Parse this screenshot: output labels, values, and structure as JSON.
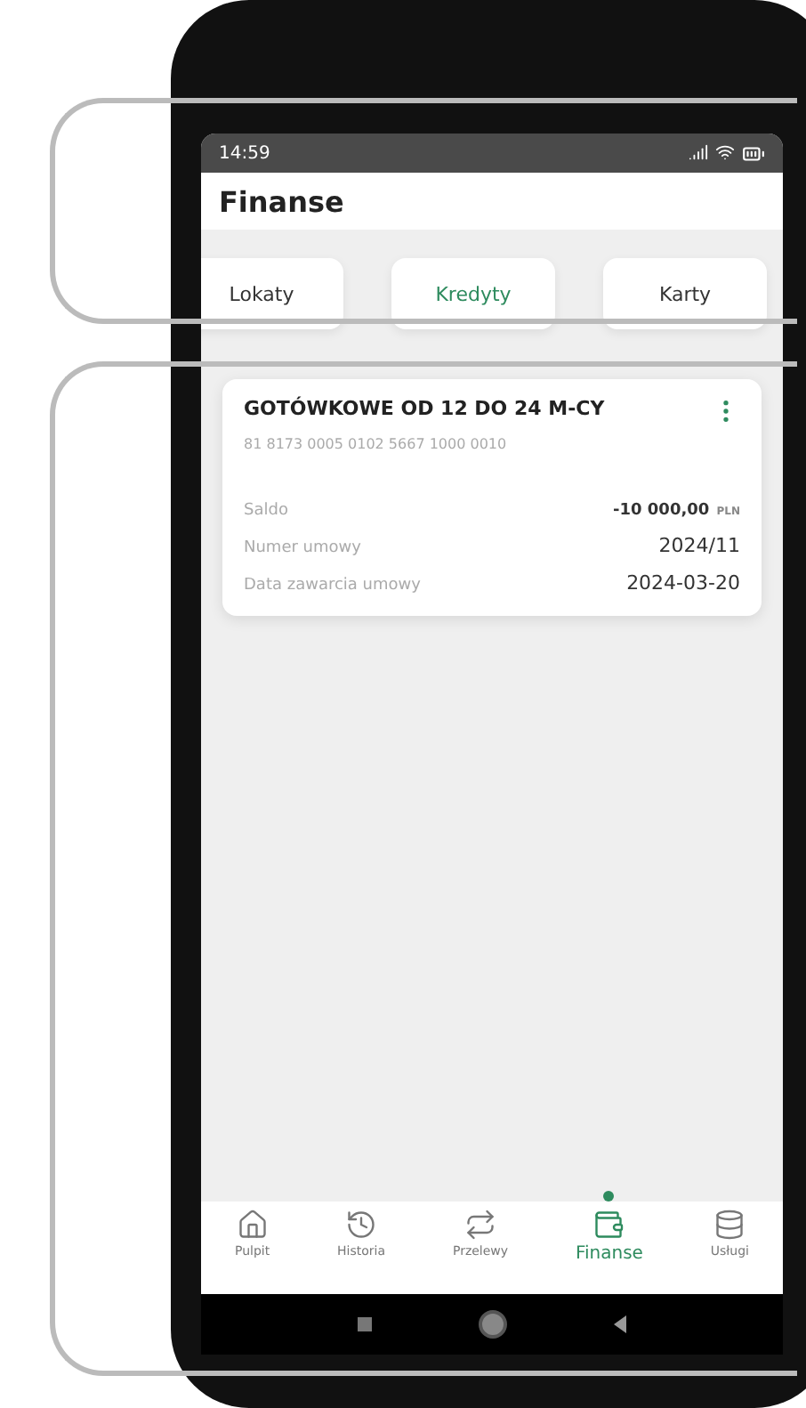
{
  "status_bar": {
    "time": "14:59"
  },
  "header": {
    "title": "Finanse"
  },
  "tabs": [
    {
      "label": "Lokaty",
      "selected": false
    },
    {
      "label": "Kredyty",
      "selected": true
    },
    {
      "label": "Karty",
      "selected": false
    }
  ],
  "card": {
    "title": "GOTÓWKOWE OD 12 DO 24 M-CY",
    "account": "81 8173 0005 0102 5667 1000 0010",
    "rows": [
      {
        "kind": "amount",
        "label": "Saldo",
        "value": "-10 000,00",
        "currency": "PLN"
      },
      {
        "kind": "plain",
        "label": "Numer umowy",
        "value": "2024/11"
      },
      {
        "kind": "plain",
        "label": "Data zawarcia umowy",
        "value": "2024-03-20"
      }
    ]
  },
  "bottom_nav": [
    {
      "label": "Pulpit",
      "selected": false
    },
    {
      "label": "Historia",
      "selected": false
    },
    {
      "label": "Przelewy",
      "selected": false
    },
    {
      "label": "Finanse",
      "selected": true
    },
    {
      "label": "Usługi",
      "selected": false
    }
  ]
}
